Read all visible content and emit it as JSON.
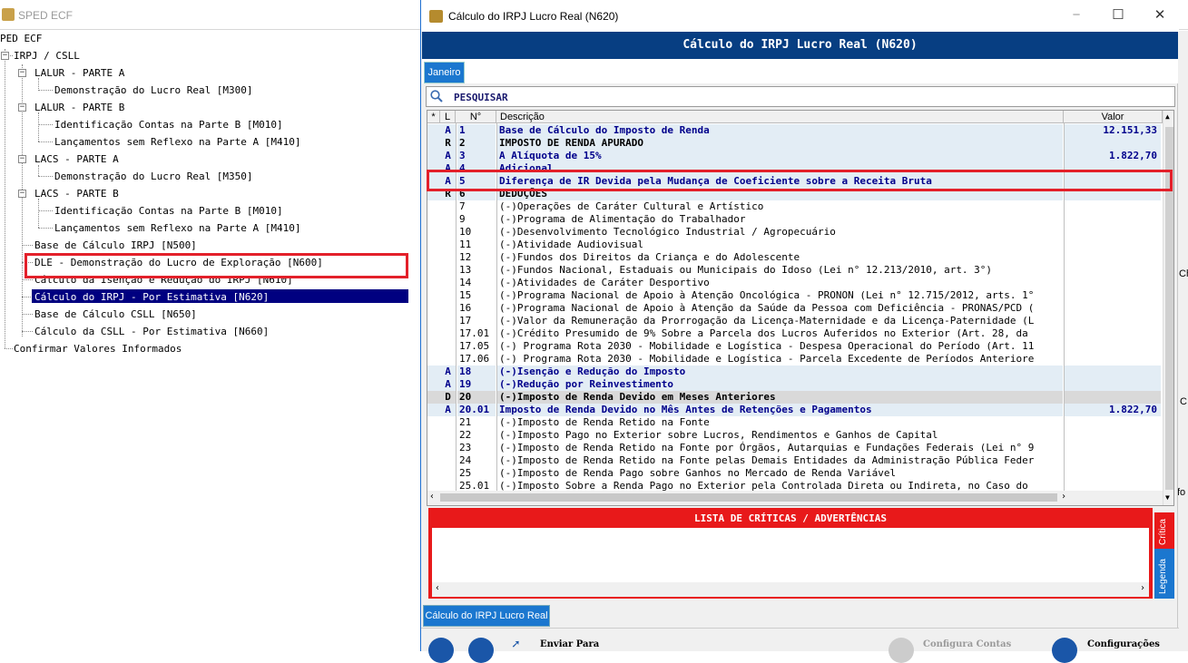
{
  "background_window": {
    "title": "SPED ECF"
  },
  "tree": [
    {
      "label": "PED ECF"
    },
    {
      "label": "IRPJ / CSLL"
    },
    {
      "label": "LALUR - PARTE A"
    },
    {
      "label": "Demonstração do Lucro Real [M300]"
    },
    {
      "label": "LALUR - PARTE B"
    },
    {
      "label": "Identificação Contas na Parte B [M010]"
    },
    {
      "label": "Lançamentos sem Reflexo na Parte A [M410]"
    },
    {
      "label": "LACS - PARTE A"
    },
    {
      "label": "Demonstração do Lucro Real [M350]"
    },
    {
      "label": "LACS - PARTE B"
    },
    {
      "label": "Identificação Contas na Parte B [M010]"
    },
    {
      "label": "Lançamentos sem Reflexo na Parte A [M410]"
    },
    {
      "label": "Base de Cálculo IRPJ [N500]"
    },
    {
      "label": "DLE - Demonstração do Lucro de Exploração [N600]"
    },
    {
      "label": "Cálculo da Isenção e Redução do IRPJ [N610]"
    },
    {
      "label": "Cálculo do IRPJ - Por Estimativa [N620]"
    },
    {
      "label": "Base de Cálculo CSLL [N650]"
    },
    {
      "label": "Cálculo da CSLL - Por Estimativa [N660]"
    },
    {
      "label": "Confirmar Valores Informados"
    }
  ],
  "right_edge_glyphs": [
    "Ch",
    "C",
    "fo"
  ],
  "dialog": {
    "title": "Cálculo do IRPJ Lucro Real (N620)",
    "header": "Cálculo do IRPJ Lucro Real (N620)",
    "tab": "Janeiro",
    "search_label": "PESQUISAR",
    "columns": {
      "star": "*",
      "l": "L",
      "n": "N°",
      "desc": "Descrição",
      "valor": "Valor"
    },
    "rows": [
      {
        "l": "A",
        "n": "1",
        "desc": "Base de Cálculo do Imposto de Renda",
        "valor": "12.151,33"
      },
      {
        "l": "R",
        "n": "2",
        "desc": "IMPOSTO DE RENDA APURADO",
        "valor": ""
      },
      {
        "l": "A",
        "n": "3",
        "desc": "A Alíquota de 15%",
        "valor": "1.822,70"
      },
      {
        "l": "A",
        "n": "4",
        "desc": "Adicional",
        "valor": ""
      },
      {
        "l": "A",
        "n": "5",
        "desc": "Diferença de IR Devida pela Mudança de Coeficiente sobre a Receita Bruta",
        "valor": ""
      },
      {
        "l": "R",
        "n": "6",
        "desc": "DEDUÇÕES",
        "valor": ""
      },
      {
        "l": "",
        "n": "7",
        "desc": "(-)Operações de Caráter Cultural e Artístico",
        "valor": ""
      },
      {
        "l": "",
        "n": "9",
        "desc": "(-)Programa de Alimentação do Trabalhador",
        "valor": ""
      },
      {
        "l": "",
        "n": "10",
        "desc": "(-)Desenvolvimento Tecnológico Industrial / Agropecuário",
        "valor": ""
      },
      {
        "l": "",
        "n": "11",
        "desc": "(-)Atividade Audiovisual",
        "valor": ""
      },
      {
        "l": "",
        "n": "12",
        "desc": "(-)Fundos dos Direitos da Criança e do Adolescente",
        "valor": ""
      },
      {
        "l": "",
        "n": "13",
        "desc": "(-)Fundos Nacional, Estaduais ou Municipais do Idoso (Lei n° 12.213/2010, art. 3°)",
        "valor": ""
      },
      {
        "l": "",
        "n": "14",
        "desc": "(-)Atividades de Caráter Desportivo",
        "valor": ""
      },
      {
        "l": "",
        "n": "15",
        "desc": "(-)Programa Nacional de Apoio à Atenção Oncológica - PRONON (Lei n° 12.715/2012, arts. 1°",
        "valor": ""
      },
      {
        "l": "",
        "n": "16",
        "desc": "(-)Programa Nacional de Apoio à Atenção da Saúde da Pessoa com Deficiência - PRONAS/PCD (",
        "valor": ""
      },
      {
        "l": "",
        "n": "17",
        "desc": "(-)Valor da Remuneração da Prorrogação da Licença-Maternidade e da Licença-Paternidade (L",
        "valor": ""
      },
      {
        "l": "",
        "n": "17.01",
        "desc": "(-)Crédito Presumido de 9% Sobre a Parcela dos Lucros Auferidos no Exterior (Art. 28, da",
        "valor": ""
      },
      {
        "l": "",
        "n": "17.05",
        "desc": "(-) Programa Rota 2030 - Mobilidade e Logística - Despesa Operacional do Período (Art. 11",
        "valor": ""
      },
      {
        "l": "",
        "n": "17.06",
        "desc": "(-) Programa Rota 2030 - Mobilidade e Logística - Parcela Excedente de Períodos Anteriore",
        "valor": ""
      },
      {
        "l": "A",
        "n": "18",
        "desc": "(-)Isenção e Redução do Imposto",
        "valor": ""
      },
      {
        "l": "A",
        "n": "19",
        "desc": "(-)Redução por Reinvestimento",
        "valor": ""
      },
      {
        "l": "D",
        "n": "20",
        "desc": "(-)Imposto de Renda Devido em Meses Anteriores",
        "valor": ""
      },
      {
        "l": "A",
        "n": "20.01",
        "desc": "Imposto de Renda Devido no Mês Antes de Retenções e Pagamentos",
        "valor": "1.822,70"
      },
      {
        "l": "",
        "n": "21",
        "desc": "(-)Imposto de Renda Retido na Fonte",
        "valor": ""
      },
      {
        "l": "",
        "n": "22",
        "desc": "(-)Imposto Pago no Exterior sobre Lucros, Rendimentos e Ganhos de Capital",
        "valor": ""
      },
      {
        "l": "",
        "n": "23",
        "desc": "(-)Imposto de Renda Retido na Fonte por Órgãos, Autarquias e Fundações Federais (Lei n° 9",
        "valor": ""
      },
      {
        "l": "",
        "n": "24",
        "desc": "(-)Imposto de Renda Retido na Fonte pelas Demais Entidades da Administração Pública Feder",
        "valor": ""
      },
      {
        "l": "",
        "n": "25",
        "desc": "(-)Imposto de Renda Pago sobre Ganhos no Mercado de Renda Variável",
        "valor": ""
      },
      {
        "l": "",
        "n": "25.01",
        "desc": "(-)Imposto Sobre a Renda Pago no Exterior pela Controlada Direta ou Indireta, no Caso do",
        "valor": ""
      }
    ],
    "crit_title": "LISTA DE CRÍTICAS / ADVERTÊNCIAS",
    "side_tabs": {
      "critica": "Crítica",
      "legenda": "Legenda"
    },
    "bottom_tab": "Cálculo do IRPJ Lucro Real",
    "bottom_buttons": {
      "enviar": "Enviar Para",
      "config_contas": "Configura Contas",
      "configuracoes": "Configurações"
    }
  }
}
